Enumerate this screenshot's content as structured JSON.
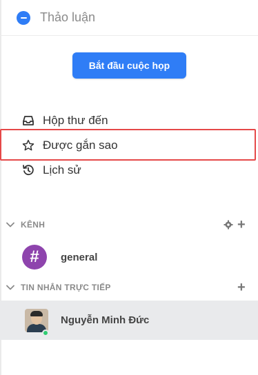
{
  "header": {
    "title": "Thảo luận",
    "icon": "chat-bubble-icon"
  },
  "start_meeting": {
    "label": "Bắt đầu cuộc họp"
  },
  "nav": {
    "items": [
      {
        "label": "Hộp thư đến",
        "icon": "inbox-icon"
      },
      {
        "label": "Được gắn sao",
        "icon": "star-icon"
      },
      {
        "label": "Lịch sử",
        "icon": "history-icon"
      }
    ]
  },
  "channels": {
    "title": "KÊNH",
    "items": [
      {
        "name": "general",
        "avatar_symbol": "#"
      }
    ]
  },
  "direct_messages": {
    "title": "TIN NHẮN TRỰC TIẾP",
    "items": [
      {
        "name": "Nguyễn Minh Đức",
        "status": "online"
      }
    ]
  },
  "colors": {
    "accent": "#2f7df6",
    "channel_avatar": "#8e44ad",
    "selected_row": "#e9eaec",
    "highlight_border": "#e54848",
    "online": "#2ecc71"
  }
}
